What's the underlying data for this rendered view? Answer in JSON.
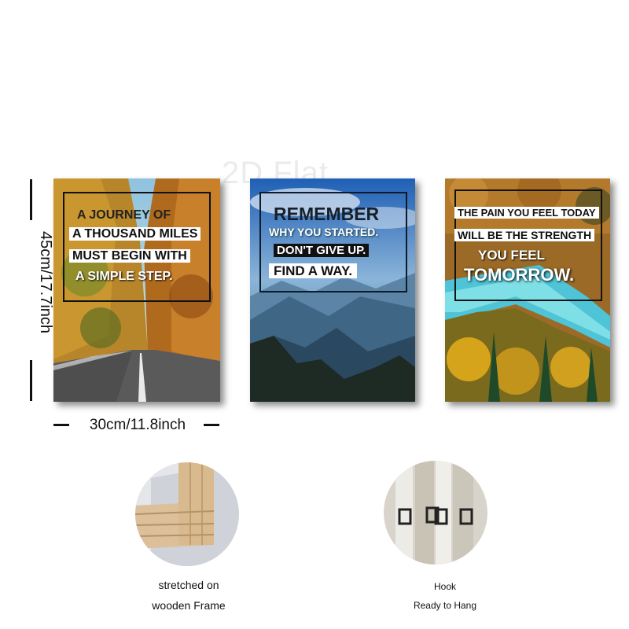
{
  "watermark": "2D Flat",
  "dimensions": {
    "height_label": "45cm/17.7inch",
    "width_label": "30cm/11.8inch"
  },
  "panels": [
    {
      "scene": "autumn-road",
      "lines": [
        "A JOURNEY OF",
        "A THOUSAND MILES",
        "MUST BEGIN WITH",
        "A SIMPLE STEP."
      ]
    },
    {
      "scene": "blue-mountains",
      "lines": [
        "REMEMBER",
        "WHY YOU STARTED.",
        "DON'T GIVE UP.",
        "FIND A WAY."
      ]
    },
    {
      "scene": "turquoise-river",
      "lines": [
        "THE PAIN YOU FEEL TODAY",
        "WILL BE THE STRENGTH",
        "YOU FEEL",
        "TOMORROW."
      ]
    }
  ],
  "features": [
    {
      "icon": "wooden-frame-corner",
      "caption_lines": [
        "stretched on",
        "wooden Frame"
      ]
    },
    {
      "icon": "hook",
      "caption_lines": [
        "Hook",
        "Ready to Hang"
      ]
    }
  ]
}
